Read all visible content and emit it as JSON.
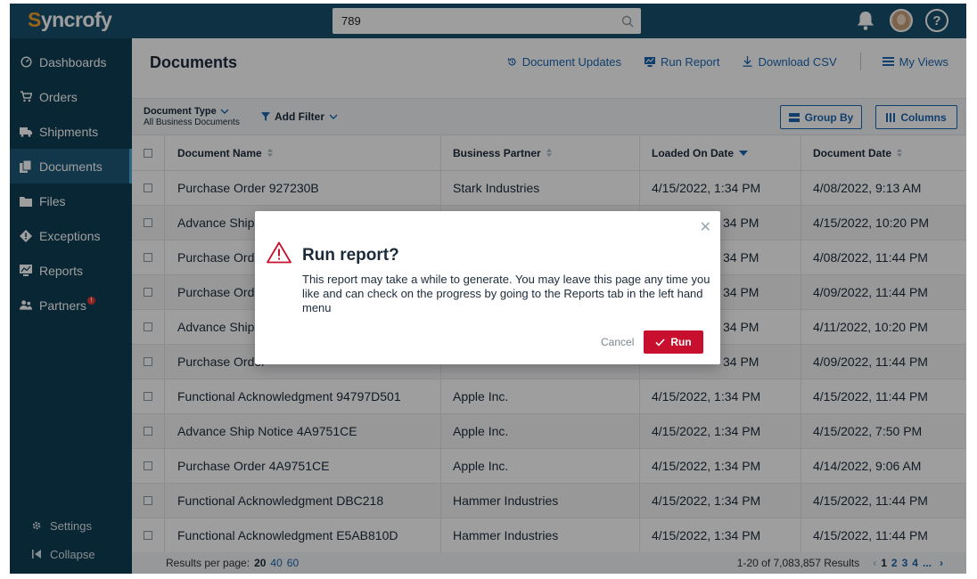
{
  "app": {
    "logo_first": "S",
    "logo_rest": "yncrofy"
  },
  "search": {
    "value": "789"
  },
  "sidebar": {
    "items": [
      {
        "label": "Dashboards",
        "icon": "dashboard-icon"
      },
      {
        "label": "Orders",
        "icon": "cart-icon"
      },
      {
        "label": "Shipments",
        "icon": "truck-icon"
      },
      {
        "label": "Documents",
        "icon": "documents-icon"
      },
      {
        "label": "Files",
        "icon": "folder-icon"
      },
      {
        "label": "Exceptions",
        "icon": "exception-icon"
      },
      {
        "label": "Reports",
        "icon": "reports-icon"
      },
      {
        "label": "Partners",
        "icon": "partners-icon",
        "badge": "!"
      }
    ],
    "settings": "Settings",
    "collapse": "Collapse"
  },
  "header": {
    "title": "Documents",
    "document_updates": "Document Updates",
    "run_report": "Run Report",
    "download_csv": "Download CSV",
    "my_views": "My Views"
  },
  "filters": {
    "doc_type_label": "Document Type",
    "doc_type_value": "All Business Documents",
    "add_filter": "Add Filter",
    "group_by": "Group By",
    "columns": "Columns"
  },
  "table": {
    "columns": [
      "Document Name",
      "Business Partner",
      "Loaded On Date",
      "Document Date"
    ],
    "rows": [
      {
        "name": "Purchase Order 927230B",
        "partner": "Stark Industries",
        "loaded": "4/15/2022, 1:34 PM",
        "date": "4/08/2022, 9:13 AM"
      },
      {
        "name": "Advance Ship N",
        "partner": "",
        "loaded": "34 PM",
        "date": "4/15/2022, 10:20 PM"
      },
      {
        "name": "Purchase Order",
        "partner": "",
        "loaded": "34 PM",
        "date": "4/08/2022, 11:44 PM"
      },
      {
        "name": "Purchase Order",
        "partner": "",
        "loaded": "34 PM",
        "date": "4/09/2022, 11:44 PM"
      },
      {
        "name": "Advance Ship N",
        "partner": "",
        "loaded": "34 PM",
        "date": "4/11/2022, 10:20 PM"
      },
      {
        "name": "Purchase Order",
        "partner": "",
        "loaded": "34 PM",
        "date": "4/09/2022, 11:44 PM"
      },
      {
        "name": "Functional Acknowledgment 94797D501",
        "partner": "Apple Inc.",
        "loaded": "4/15/2022, 1:34 PM",
        "date": "4/15/2022, 11:44 PM"
      },
      {
        "name": "Advance Ship Notice 4A9751CE",
        "partner": "Apple Inc.",
        "loaded": "4/15/2022, 1:34 PM",
        "date": "4/15/2022, 7:50 PM"
      },
      {
        "name": "Purchase Order 4A9751CE",
        "partner": "Apple Inc.",
        "loaded": "4/15/2022, 1:34 PM",
        "date": "4/14/2022, 9:06 AM"
      },
      {
        "name": "Functional Acknowledgment DBC218",
        "partner": "Hammer Industries",
        "loaded": "4/15/2022, 1:34 PM",
        "date": "4/15/2022, 11:44 PM"
      },
      {
        "name": "Functional Acknowledgment E5AB810D",
        "partner": "Hammer Industries",
        "loaded": "4/15/2022, 1:34 PM",
        "date": "4/15/2022, 11:44 PM"
      }
    ]
  },
  "footer": {
    "results_per_page": "Results per page:",
    "rpp_selected": "20",
    "rpp_opt1": "40",
    "rpp_opt2": "60",
    "results_count": "1-20 of 7,083,857 Results",
    "pages": [
      "1",
      "2",
      "3",
      "4"
    ],
    "ellipsis": "..."
  },
  "modal": {
    "title": "Run report?",
    "body": "This report may take a while to generate. You may leave this page any time you like and can check on the progress by going to the Reports tab in the left hand menu",
    "cancel": "Cancel",
    "run": "Run"
  },
  "colors": {
    "topbar": "#17506c",
    "sidebar": "#0f3e55",
    "accent": "#1a66b0",
    "logo_accent": "#f4a32b",
    "danger": "#c8102e"
  }
}
